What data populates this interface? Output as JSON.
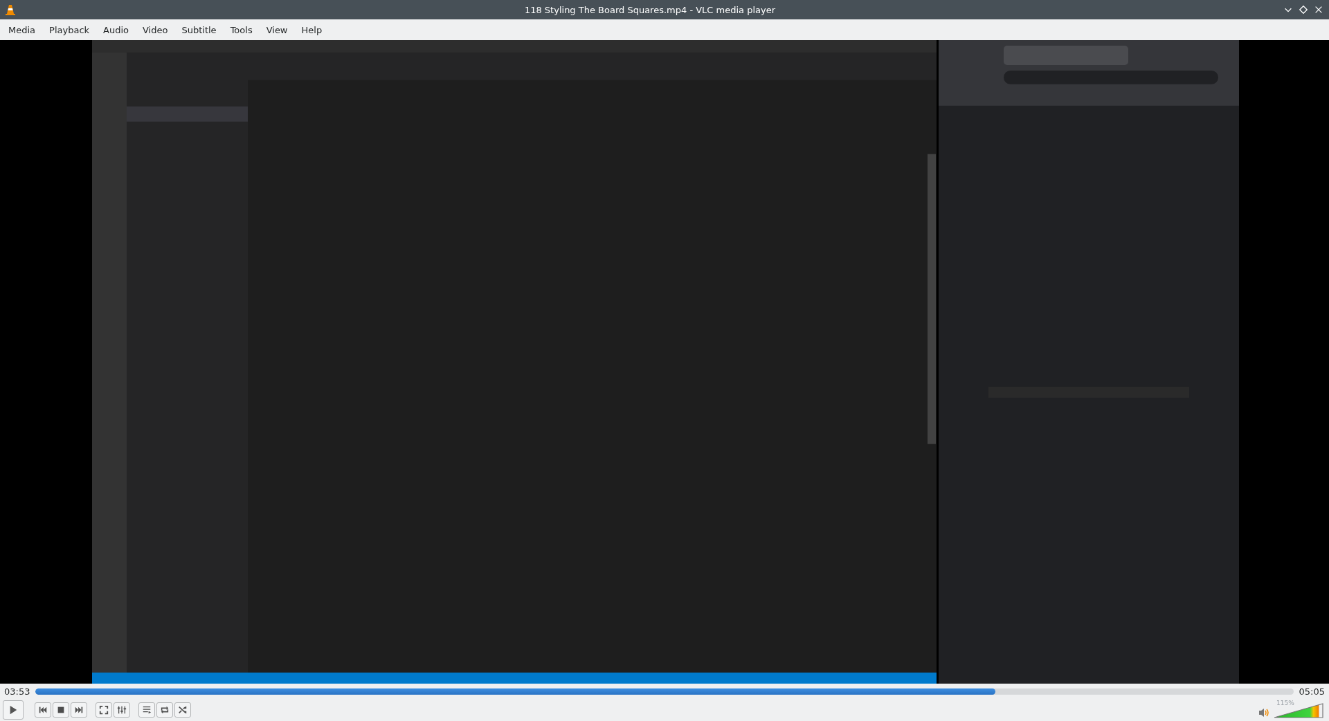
{
  "window": {
    "title": "118 Styling The Board Squares.mp4 - VLC media player"
  },
  "menu": [
    "Media",
    "Playback",
    "Audio",
    "Video",
    "Subtitle",
    "Tools",
    "View",
    "Help"
  ],
  "seek": {
    "elapsed": "03:53",
    "total": "05:05",
    "level": 0.763
  },
  "volume": {
    "reading": "115%",
    "level": 0.92
  }
}
